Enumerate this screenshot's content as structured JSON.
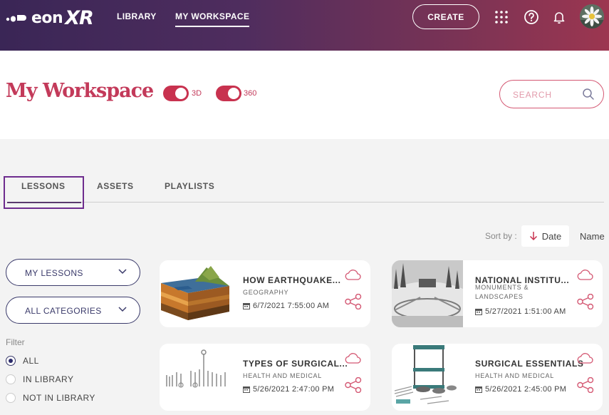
{
  "header": {
    "logo_text": "eon",
    "logo_xr": "XR",
    "nav": [
      {
        "label": "LIBRARY",
        "active": false
      },
      {
        "label": "MY WORKSPACE",
        "active": true
      }
    ],
    "create_label": "CREATE",
    "icons": [
      "apps-grid-icon",
      "help-icon",
      "bell-icon",
      "avatar"
    ]
  },
  "page": {
    "title": "My Workspace",
    "toggles": [
      {
        "label": "3D",
        "on": true
      },
      {
        "label": "360",
        "on": true
      }
    ],
    "search_placeholder": "SEARCH"
  },
  "tabs": [
    {
      "label": "LESSONS",
      "active": true
    },
    {
      "label": "ASSETS",
      "active": false
    },
    {
      "label": "PLAYLISTS",
      "active": false
    }
  ],
  "sort": {
    "label": "Sort by :",
    "options": [
      {
        "label": "Date",
        "active": true,
        "direction": "descending"
      },
      {
        "label": "Name",
        "active": false
      }
    ]
  },
  "filters": {
    "dropdowns": [
      {
        "selected": "MY LESSONS"
      },
      {
        "selected": "ALL CATEGORIES"
      }
    ],
    "filter_label": "Filter",
    "radios": [
      {
        "label": "ALL",
        "checked": true
      },
      {
        "label": "IN LIBRARY",
        "checked": false
      },
      {
        "label": "NOT IN LIBRARY",
        "checked": false
      }
    ]
  },
  "lessons": [
    {
      "title": "HOW EARTHQUAKE...",
      "category": "GEOGRAPHY",
      "date": "6/7/2021 7:55:00 AM",
      "thumb": "earthquake"
    },
    {
      "title": "NATIONAL INSTITU...",
      "category": "MONUMENTS & LANDSCAPES",
      "date": "5/27/2021 1:51:00 AM",
      "thumb": "snow-panorama"
    },
    {
      "title": "TYPES OF SURGICAL...",
      "category": "HEALTH AND MEDICAL",
      "date": "5/26/2021 2:47:00 PM",
      "thumb": "surgical-tools"
    },
    {
      "title": "SURGICAL ESSENTIALS",
      "category": "HEALTH AND MEDICAL",
      "date": "5/26/2021 2:45:00 PM",
      "thumb": "surgical-cart"
    }
  ],
  "colors": {
    "accent": "#c33a5a",
    "header_start": "#3a2656",
    "header_end": "#9c3650",
    "tab_focus": "#6e2c8e"
  }
}
